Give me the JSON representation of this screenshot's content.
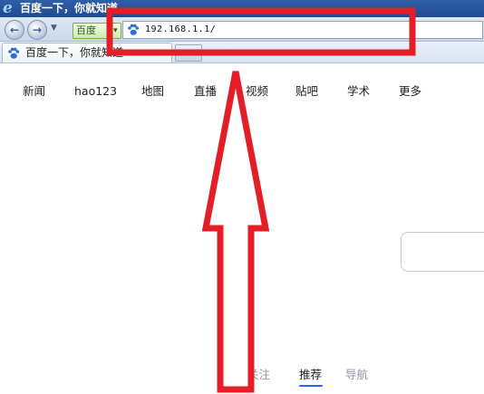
{
  "window": {
    "title": "百度一下，你就知道"
  },
  "toolbar": {
    "back_glyph": "←",
    "forward_glyph": "→",
    "history_dropdown_glyph": "▼",
    "green_button_label": "百度",
    "green_button_dropdown_glyph": "▾",
    "address": "192.168.1.1/",
    "address_icon": "baidu-paw-icon"
  },
  "tabs": [
    {
      "label": "百度一下，你就知道",
      "close_glyph": "×",
      "icon": "baidu-paw-icon"
    }
  ],
  "page": {
    "top_nav": [
      "新闻",
      "hao123",
      "地图",
      "直播",
      "视频",
      "贴吧",
      "学术",
      "更多"
    ],
    "feed_tabs": [
      "我的关注",
      "推荐",
      "导航"
    ],
    "active_feed_tab": "推荐"
  },
  "annotation": {
    "color": "#e41e26",
    "shapes": [
      "highlight-rectangle",
      "up-arrow"
    ]
  }
}
